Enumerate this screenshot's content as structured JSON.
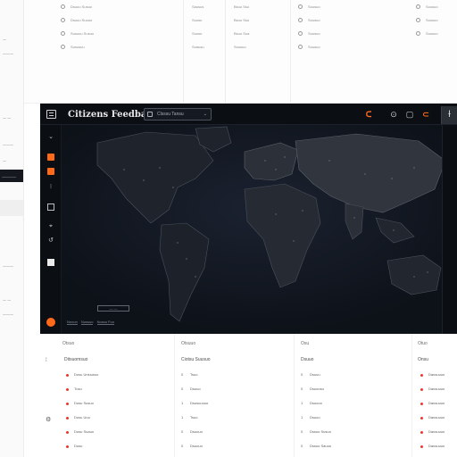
{
  "left_panel": {
    "items": [
      "—",
      "———",
      "— —",
      "———",
      "—",
      "———",
      "— —",
      "———"
    ],
    "selected_label": "————"
  },
  "top_bg": {
    "col1": [
      "Dsuuu Susuo",
      "Dsuuu Suuuo",
      "Susuuu Susuo",
      "Sususuu"
    ],
    "col2": [
      "Sausus",
      "Sousu",
      "Sousu",
      "Soausu"
    ],
    "col3": [
      "Bsuu Ssu",
      "Bsuu Ssu",
      "Bsuu Sua",
      "Sousuo"
    ],
    "col4": [
      "Sousuo",
      "Sousuo",
      "Sousuo",
      "Sousuo"
    ]
  },
  "toolbar": {
    "title": "Citizens Feedback",
    "search_text": "Clsssu Tansu",
    "icons": [
      "bell-icon",
      "circle-icon",
      "square-icon",
      "cup-icon",
      "person-icon"
    ]
  },
  "map": {
    "scale_label": "— —",
    "footer_links": [
      "Nnoon",
      "Nossuo",
      "Nossu Foo"
    ]
  },
  "table": {
    "headers": [
      "Otsuo",
      "Otsuuo",
      "Osu",
      "Otuo"
    ],
    "subheaders": [
      "Ditsuomsuo",
      "Ciotsu Suusuo",
      "Dsuuo",
      "Onsu"
    ],
    "rows": [
      [
        "Dosu Uniuusuo",
        "Tsuo",
        "Dsuuu",
        "Dausuuuo"
      ],
      [
        "Tusu",
        "Dsuuo",
        "Dsuoosu",
        "Dausuuuo"
      ],
      [
        "Dusu Susuo",
        "Dsusuuuuo",
        "Dsuooo",
        "Dausuuuo"
      ],
      [
        "Dusu Uuu",
        "Tsuo",
        "Dsuuo",
        "Dausuuuo"
      ],
      [
        "Dusu Suauo",
        "Dsuuuo",
        "Dssuo Susuo",
        "Dausuuuo"
      ],
      [
        "Dusu",
        "Dsuuuo",
        "Dssuo Sauuo",
        "Dausuuuo"
      ]
    ],
    "row_numbers": [
      "0",
      "0",
      "1",
      "1",
      "0",
      "0"
    ]
  },
  "colors": {
    "accent": "#ff6a1a",
    "window_bg": "#0f131a",
    "danger_dot": "#e53935"
  }
}
